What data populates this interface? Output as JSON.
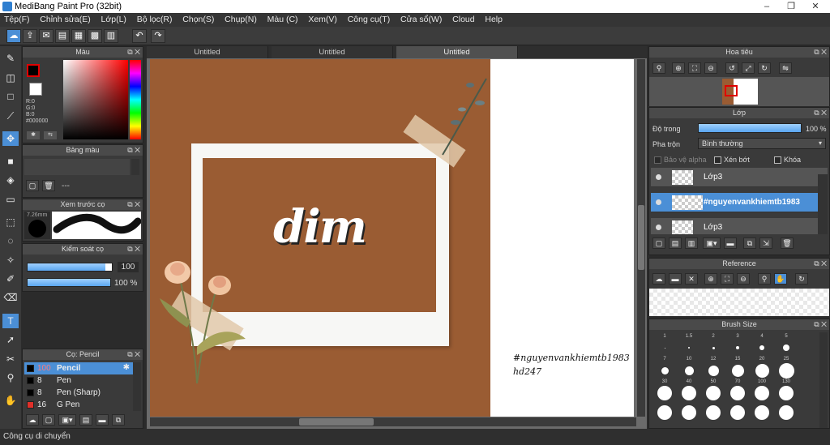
{
  "window": {
    "title": "MediBang Paint Pro (32bit)",
    "minimize": "–",
    "maximize": "❐",
    "close": "✕"
  },
  "menu": [
    "Tệp(F)",
    "Chỉnh sửa(E)",
    "Lớp(L)",
    "Bộ lọc(R)",
    "Chọn(S)",
    "Chụp(N)",
    "Màu (C)",
    "Xem(V)",
    "Công cụ(T)",
    "Cửa sổ(W)",
    "Cloud",
    "Help"
  ],
  "tabs": [
    {
      "label": "Untitled",
      "active": false
    },
    {
      "label": "Untitled",
      "active": false
    },
    {
      "label": "Untitled",
      "active": true
    }
  ],
  "color_panel": {
    "title": "Màu",
    "r": "R:0",
    "g": "G:0",
    "b": "B:0",
    "hex": "#000000",
    "foreground": "#000000",
    "accent": "#ff0000"
  },
  "palette_panel": {
    "title": "Bảng màu",
    "value": "---"
  },
  "brush_preview": {
    "title": "Xem trước cọ",
    "size": "7.26mm"
  },
  "brush_control": {
    "title": "Kiểm soát cọ",
    "size_value": "100",
    "opacity_value": "100 %",
    "size_fraction": 0.92,
    "opacity_fraction": 1.0
  },
  "brush_list": {
    "title": "Cọ: Pencil",
    "items": [
      {
        "size": "100",
        "name": "Pencil",
        "color": "#000000",
        "selected": true
      },
      {
        "size": "8",
        "name": "Pen",
        "color": "#000000",
        "selected": false
      },
      {
        "size": "8",
        "name": "Pen (Sharp)",
        "color": "#000000",
        "selected": false
      },
      {
        "size": "16",
        "name": "G Pen",
        "color": "#e0302a",
        "selected": false
      }
    ]
  },
  "canvas": {
    "big_text": "dim",
    "hashtag": "#nguyenvankhiemtb1983",
    "subtag": "hd247",
    "bg_color": "#9a5c33"
  },
  "navigator": {
    "title": "Hoa tiêu"
  },
  "layers": {
    "title": "Lớp",
    "opacity_label": "Độ trong",
    "opacity_value": "100 %",
    "opacity_fraction": 1.0,
    "blend_label": "Pha trộn",
    "blend_value": "Bình thường",
    "protect_alpha": "Bảo vệ alpha",
    "clip": "Xén bớt",
    "lock": "Khóa",
    "items": [
      {
        "name": "Lớp3",
        "selected": false
      },
      {
        "name": "#nguyenvankhiemtb1983",
        "selected": true
      },
      {
        "name": "Lớp3",
        "selected": false
      }
    ]
  },
  "reference": {
    "title": "Reference"
  },
  "brush_size": {
    "title": "Brush Size",
    "values": [
      "1",
      "1.5",
      "2",
      "3",
      "4",
      "5",
      "7",
      "10",
      "12",
      "15",
      "20",
      "25",
      "30",
      "40",
      "50",
      "70",
      "100",
      "130",
      "",
      "",
      "",
      "",
      "",
      ""
    ]
  },
  "status": {
    "text": "Công cụ di chuyển"
  }
}
